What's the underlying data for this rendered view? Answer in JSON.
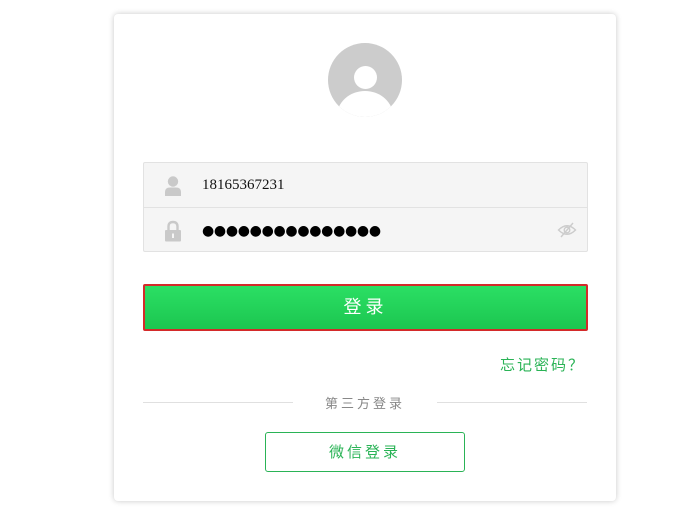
{
  "login_form": {
    "username": {
      "icon": "user-icon",
      "value": "18165367231"
    },
    "password": {
      "icon": "lock-icon",
      "masked_value": "●●●●●●●●●●●●●●●",
      "toggle_icon": "eye-hidden-icon"
    },
    "submit_label": "登录",
    "forgot_label": "忘记密码？"
  },
  "third_party": {
    "label": "第三方登录",
    "wechat_label": "微信登录"
  },
  "colors": {
    "primary_green": "#1cc650",
    "link_green": "#2ab356",
    "focus_outline": "#d42a2a"
  }
}
